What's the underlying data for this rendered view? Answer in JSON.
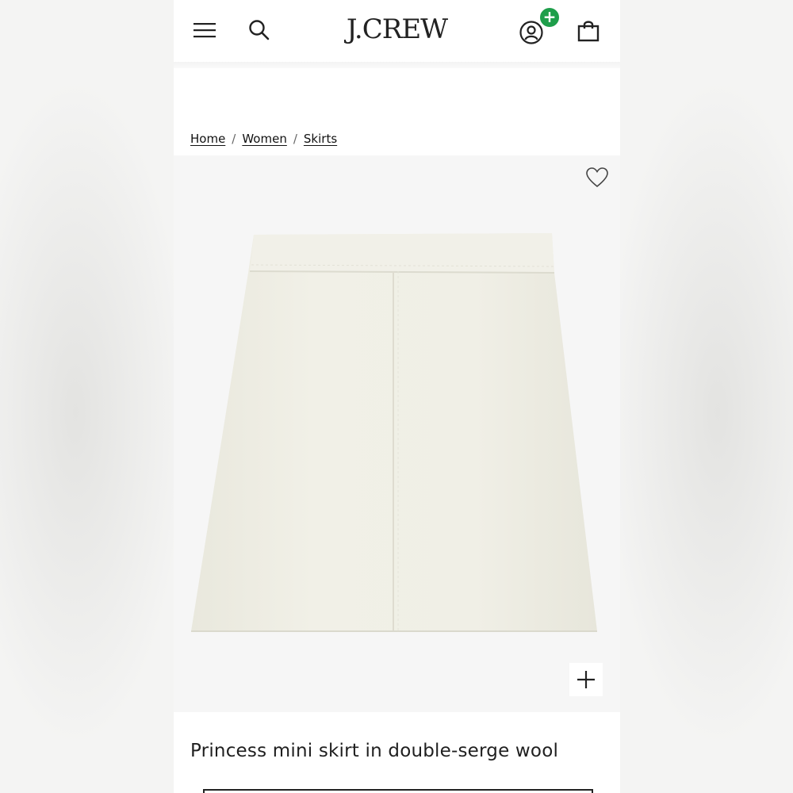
{
  "header": {
    "logo": "J.CREW",
    "badge": "+"
  },
  "breadcrumb": {
    "items": [
      "Home",
      "Women",
      "Skirts"
    ],
    "separator": "/"
  },
  "product": {
    "title": "Princess mini skirt in double-serge wool",
    "image_alt": "ivory skirt"
  },
  "colors": {
    "badge": "#1e9e4a",
    "skirt": "#efeee4"
  },
  "icons": {
    "menu": "menu-icon",
    "search": "search-icon",
    "account": "account-icon",
    "bag": "bag-icon",
    "wishlist": "heart-icon",
    "zoom": "plus-icon"
  }
}
